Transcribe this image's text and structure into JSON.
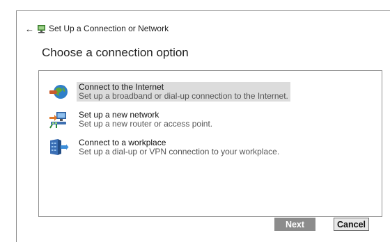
{
  "window": {
    "title": "Set Up a Connection or Network",
    "back_arrow": "←"
  },
  "heading": "Choose a connection option",
  "options": [
    {
      "title": "Connect to the Internet",
      "description": "Set up a broadband or dial-up connection to the Internet.",
      "icon": "globe-connection-icon",
      "selected": true
    },
    {
      "title": "Set up a new network",
      "description": "Set up a new router or access point.",
      "icon": "new-network-icon",
      "selected": false
    },
    {
      "title": "Connect to a workplace",
      "description": "Set up a dial-up or VPN connection to your workplace.",
      "icon": "workplace-connection-icon",
      "selected": false
    }
  ],
  "buttons": {
    "next": "Next",
    "cancel": "Cancel"
  },
  "colors": {
    "selected_bg": "#dcdcdc",
    "next_bg": "#8c8c8c",
    "cancel_bg": "#e8e8e8"
  }
}
